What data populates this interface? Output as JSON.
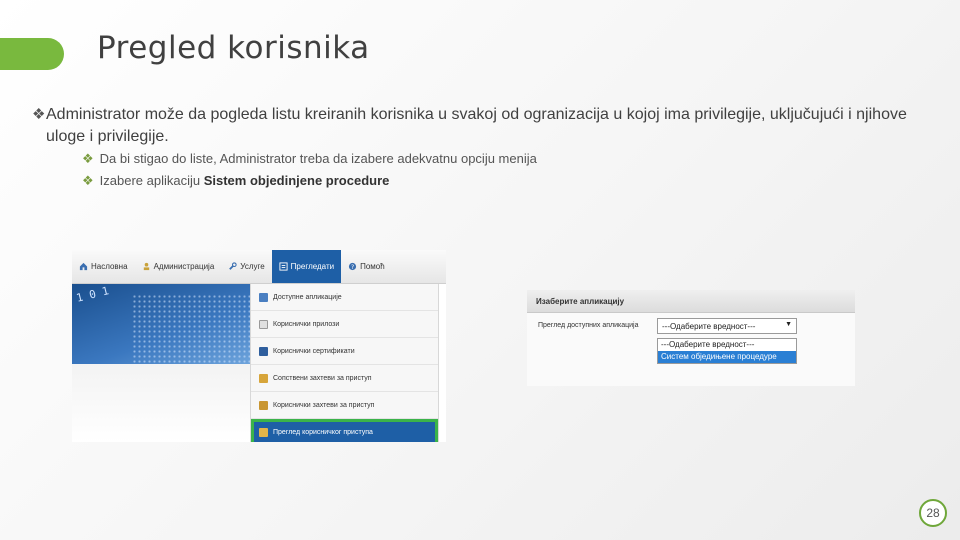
{
  "slide": {
    "title": "Pregled korisnika",
    "bullet_mark": "❖",
    "bullet_main": "Administrator može da pogleda listu kreiranih korisnika u svakoj od ogranizacija u kojoj ima privilegije, uključujući i njihove uloge i privilegije.",
    "sub_bullets": [
      {
        "text": "Da bi stigao do liste, Administrator treba da izabere adekvatnu opciju menija"
      },
      {
        "text_prefix": "Izabere aplikaciju ",
        "text_bold": "Sistem objedinjene procedure"
      }
    ],
    "page_number": "28",
    "accent_color": "#79b93e"
  },
  "menu_screenshot": {
    "nav": [
      {
        "label": "Насловна",
        "icon": "home-icon"
      },
      {
        "label": "Администрација",
        "icon": "admin-icon"
      },
      {
        "label": "Услуге",
        "icon": "wrench-icon"
      },
      {
        "label": "Прегледати",
        "icon": "list-icon",
        "active": true
      },
      {
        "label": "Помоћ",
        "icon": "help-icon"
      }
    ],
    "banner_digits": "1 0 1",
    "dropdown": [
      {
        "label": "Доступне апликације",
        "icon": "apps-icon"
      },
      {
        "label": "Кориснички прилози",
        "icon": "document-icon"
      },
      {
        "label": "Кориснички сертификати",
        "icon": "certificate-icon"
      },
      {
        "label": "Сопствени захтеви за приступ",
        "icon": "lock-icon"
      },
      {
        "label": "Кориснички захтеви за приступ",
        "icon": "user-lock-icon"
      },
      {
        "label": "Преглед корисничког приступа",
        "icon": "access-icon",
        "selected": true
      }
    ],
    "active_color": "#1e5fa6",
    "highlight_color": "#3bb34a"
  },
  "app_select_screenshot": {
    "panel_title": "Изаберите апликацију",
    "row_label": "Преглед доступних апликација",
    "select_value": "---Одаберите вредност---",
    "options": [
      {
        "label": "---Одаберите вредност---"
      },
      {
        "label": "Систем обједињене процедуре",
        "highlighted": true
      }
    ]
  }
}
